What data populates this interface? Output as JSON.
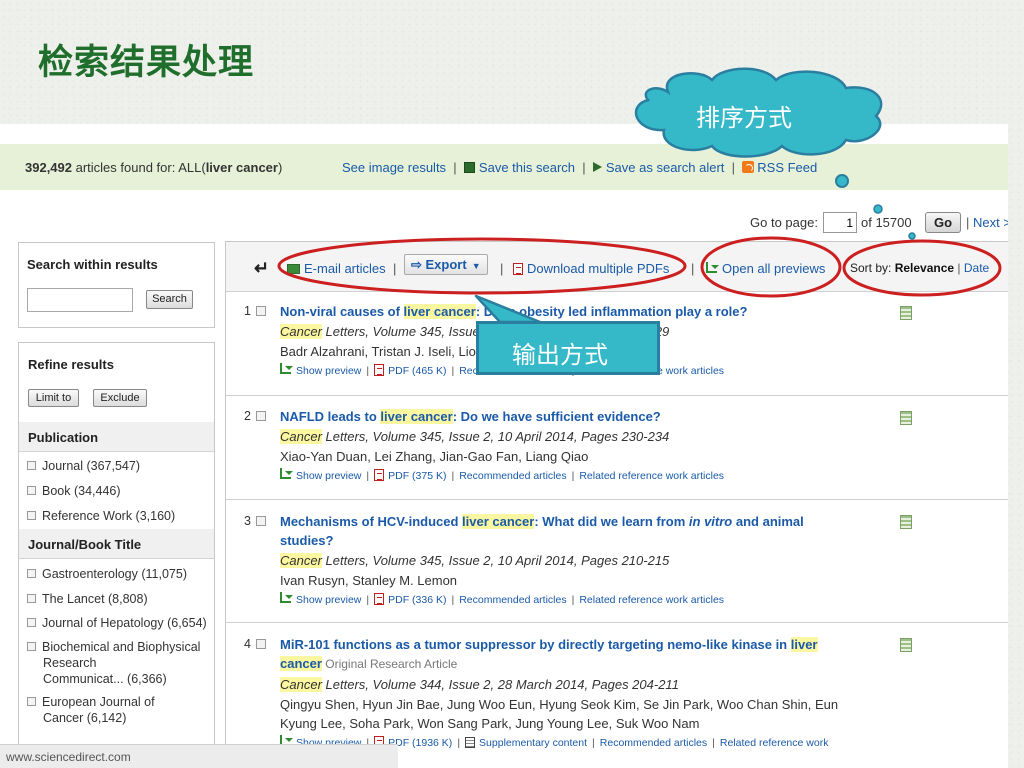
{
  "slide": {
    "title": "检索结果处理"
  },
  "search_summary": {
    "count": "392,492",
    "found_text": " articles found for: ALL(",
    "query": "liver cancer",
    "close_paren": ")"
  },
  "top_actions": {
    "image_results": "See image results",
    "save_search": "Save this search",
    "save_alert": "Save as search alert",
    "rss": "RSS Feed"
  },
  "pager": {
    "goto_label": "Go to page:",
    "current_page": "1",
    "of_text": "of 15700",
    "go_label": "Go",
    "next_label": "Next >"
  },
  "sidebar": {
    "search_title": "Search within results",
    "search_button": "Search",
    "refine_title": "Refine results",
    "limit_to": "Limit to",
    "exclude": "Exclude",
    "publication_title": "Publication",
    "publication_items": [
      "Journal (367,547)",
      "Book (34,446)",
      "Reference Work (3,160)"
    ],
    "journal_title": "Journal/Book Title",
    "journal_items": [
      "Gastroenterology (11,075)",
      "The Lancet (8,808)",
      "Journal of Hepatology (6,654)"
    ],
    "journal_item_bio": [
      "Biochemical and Biophysical",
      "Research",
      "Communicat... (6,366)"
    ],
    "journal_item_euro": [
      "European Journal of",
      "Cancer (6,142)"
    ]
  },
  "toolbar": {
    "email": "E-mail articles",
    "export": "Export",
    "download_pdfs": "Download multiple PDFs",
    "open_previews": "Open all previews",
    "sort_by": "Sort by: ",
    "sort_relevance": "Relevance",
    "sort_date": "Date"
  },
  "results": [
    {
      "num": "1",
      "title_pre": "Non-viral causes of ",
      "title_hl": "liver cancer",
      "title_post": ": Does obesity led inflammation play a role?",
      "journal_hl": "Cancer",
      "journal_rest": " Letters, Volume 345, Issue 2, 10 April 2014, Pages 223-229",
      "authors": "Badr Alzahrani, Tristan J. Iseli, Lionel Hebbard",
      "preview": "Show preview",
      "pdf": "PDF (465 K)",
      "recommended": "Recommended articles",
      "related": "Related reference work articles"
    },
    {
      "num": "2",
      "title_pre": "NAFLD leads to ",
      "title_hl": "liver cancer",
      "title_post": ": Do we have sufficient evidence?",
      "journal_hl": "Cancer",
      "journal_rest": " Letters, Volume 345, Issue 2, 10 April 2014, Pages 230-234",
      "authors": "Xiao-Yan Duan, Lei Zhang, Jian-Gao Fan, Liang Qiao",
      "preview": "Show preview",
      "pdf": "PDF (375 K)",
      "recommended": "Recommended articles",
      "related": "Related reference work articles"
    },
    {
      "num": "3",
      "title_pre": "Mechanisms of HCV-induced ",
      "title_hl": "liver cancer",
      "title_mid": ": What did we learn from ",
      "title_it": "in vitro",
      "title_post": " and animal",
      "title_line2": "studies?",
      "journal_hl": "Cancer",
      "journal_rest": " Letters, Volume 345, Issue 2, 10 April 2014, Pages 210-215",
      "authors": "Ivan Rusyn, Stanley M. Lemon",
      "preview": "Show preview",
      "pdf": "PDF (336 K)",
      "recommended": "Recommended articles",
      "related": "Related reference work articles"
    },
    {
      "num": "4",
      "title_pre": "MiR-101 functions as a tumor suppressor by directly targeting nemo-like kinase in ",
      "title_hl": "liver",
      "title_hl2": "cancer",
      "article_type": " Original Research Article",
      "journal_hl": "Cancer",
      "journal_rest": " Letters, Volume 344, Issue 2, 28 March 2014, Pages 204-211",
      "authors": "Qingyu Shen, Hyun Jin Bae, Jung Woo Eun, Hyung Seok Kim, Se Jin Park, Woo Chan Shin, Eun",
      "authors2": "Kyung Lee, Soha Park, Won Sang Park, Jung Young Lee, Suk Woo Nam",
      "preview": "Show preview",
      "pdf": "PDF (1936 K)",
      "supplementary": "Supplementary content",
      "recommended": "Recommended articles",
      "related": "Related reference work"
    }
  ],
  "footer": {
    "url": "www.sciencedirect.com"
  },
  "callouts": {
    "sort": "排序方式",
    "output": "输出方式"
  },
  "colors": {
    "title_green": "#1f6e2c",
    "link_blue": "#1a5aa8",
    "highlight": "#fbf6a0",
    "annotation_red": "#cc1f1f",
    "callout_teal": "#35b8c8"
  }
}
